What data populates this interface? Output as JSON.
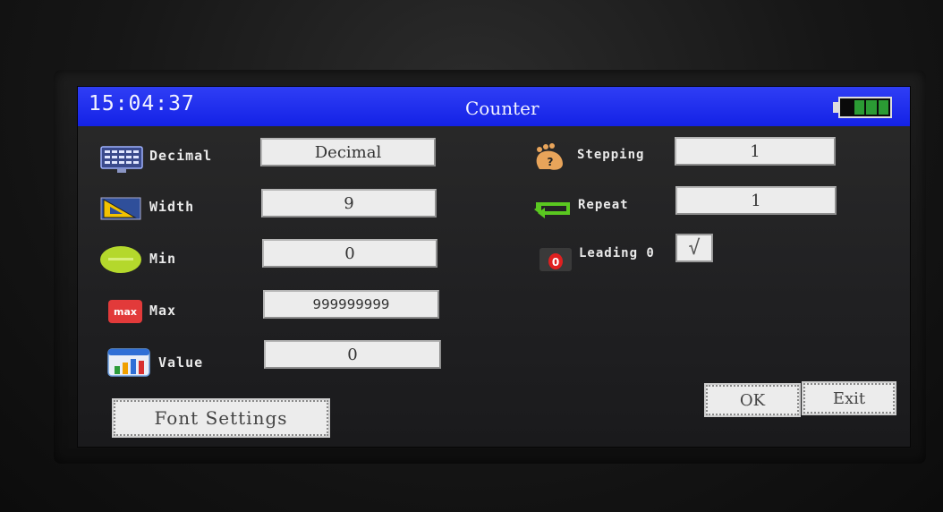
{
  "header": {
    "time": "15:04:37",
    "title": "Counter",
    "battery_level": 0.75
  },
  "left_fields": [
    {
      "label": "Decimal",
      "value": "Decimal",
      "icon": "numpad-monitor-icon"
    },
    {
      "label": "Width",
      "value": "9",
      "icon": "ruler-triangle-icon"
    },
    {
      "label": "Min",
      "value": "0",
      "icon": "green-oval-icon"
    },
    {
      "label": "Max",
      "value": "999999999",
      "icon": "max-badge-icon"
    },
    {
      "label": "Value",
      "value": "0",
      "icon": "bar-chart-icon"
    }
  ],
  "right_fields": [
    {
      "label": "Stepping",
      "value": "1",
      "icon": "footstep-icon"
    },
    {
      "label": "Repeat",
      "value": "1",
      "icon": "repeat-arrow-icon"
    }
  ],
  "leading_zero": {
    "label": "Leading 0",
    "checked": true,
    "check_mark": "√",
    "icon": "zero-badge-icon"
  },
  "buttons": {
    "font_settings": "Font Settings",
    "ok": "OK",
    "exit": "Exit"
  },
  "colors": {
    "titlebar": "#1a2af0",
    "battery": "#2b9b34",
    "screen_bg": "#222224"
  }
}
